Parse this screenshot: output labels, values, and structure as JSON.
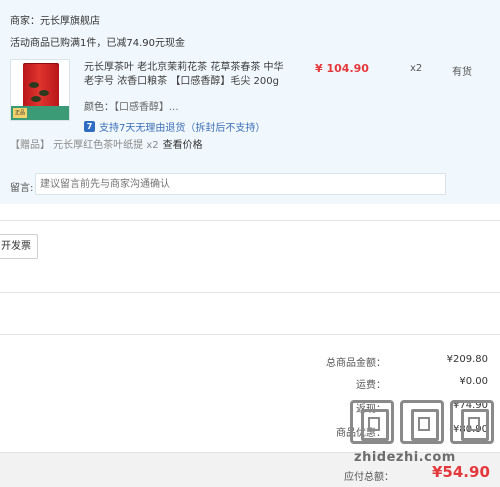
{
  "order": {
    "shop_line": "商家：元长厚旗舰店",
    "promo_line": "活动商品已购满1件，已减74.90元现金",
    "item": {
      "title": "元长厚茶叶 老北京茉莉花茶 花草茶春茶 中华老字号 浓香口粮茶 【口感香醇】毛尖 200g",
      "price": "¥ 104.90",
      "qty": "x2",
      "stock": "有货",
      "attr_label": "颜色：",
      "attr_value": "【口感香醇】...",
      "service_badge": "7",
      "service_text": "支持7天无理由退货（拆封后不支持）",
      "thumb_tag": "正品"
    },
    "gift_text": "【赠品】 元长厚红色茶叶纸提 x2",
    "gift_link": "查看价格",
    "message_label": "留言:",
    "message_placeholder": "建议留言前先与商家沟通确认"
  },
  "invoice_button": "开发票",
  "summary": [
    {
      "label": "总商品金额：",
      "value": "¥209.80"
    },
    {
      "label": "运费：",
      "value": "¥0.00"
    },
    {
      "label": "返现：",
      "value": "-¥74.90"
    },
    {
      "label": "商品优惠：",
      "value": "-¥80.90"
    }
  ],
  "footer": {
    "label": "应付总额：",
    "value": "¥54.90"
  },
  "watermark": {
    "text": "zhidezhi.com"
  },
  "colors": {
    "accent_red": "#e4393c",
    "link_blue": "#3d6fb5",
    "card_bg": "#f1f8fd"
  }
}
